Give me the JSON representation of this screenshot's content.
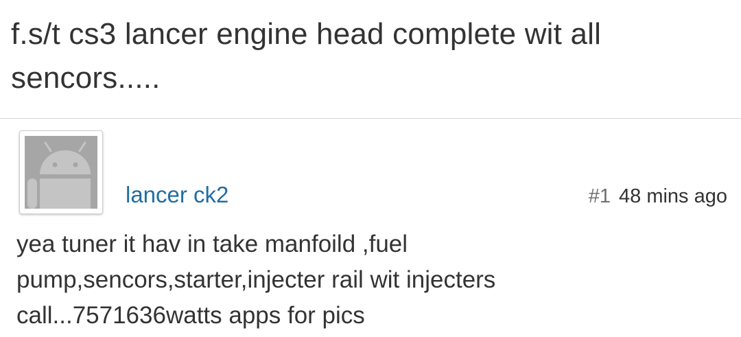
{
  "thread": {
    "title": "f.s/t cs3 lancer engine head complete wit all sencors....."
  },
  "post": {
    "author": "lancer ck2",
    "avatar_icon": "android-robot-icon",
    "number": "#1",
    "time": "48 mins ago",
    "body_lines": [
      "yea tuner it hav in take manfoild ,fuel",
      "pump,sencors,starter,injecter rail wit injecters",
      "call...7571636watts apps for pics"
    ]
  },
  "colors": {
    "username": "#1f6ea3",
    "text": "#333333",
    "post_number": "#6f6f6f",
    "avatar_background": "#a6a6a6",
    "divider": "#d6d6d6"
  }
}
